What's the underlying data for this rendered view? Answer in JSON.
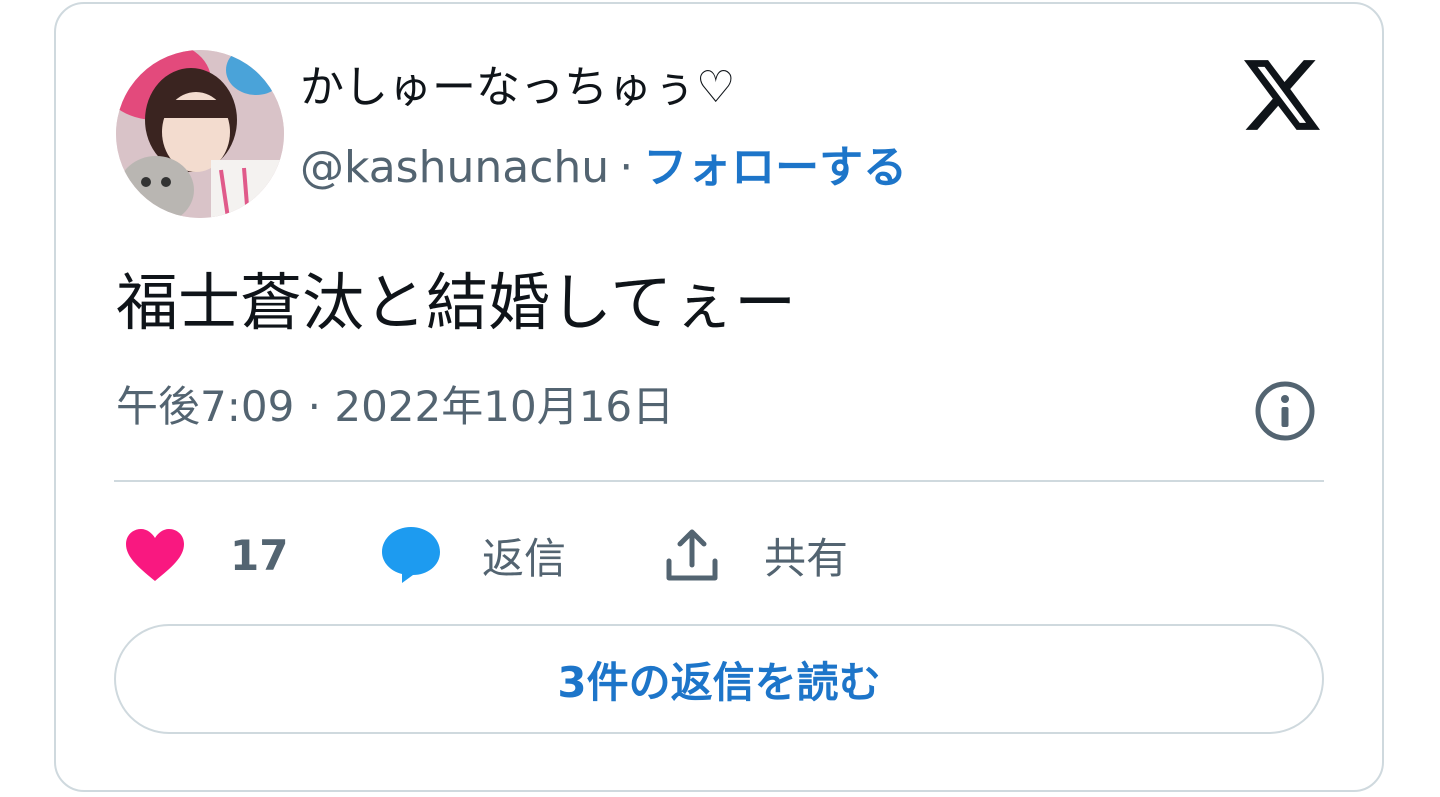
{
  "author": {
    "display_name": "かしゅーなっちゅぅ♡",
    "handle": "@kashunachu",
    "separator": "·",
    "follow_label": "フォローする",
    "avatar_icon": "user-avatar-photo"
  },
  "brand": {
    "logo_icon": "x-logo-icon"
  },
  "tweet": {
    "text": "福士蒼汰と結婚してぇー",
    "timestamp": "午後7:09 · 2022年10月16日"
  },
  "actions": {
    "like_icon": "heart-icon",
    "like_count": "17",
    "reply_icon": "speech-bubble-icon",
    "reply_label": "返信",
    "share_icon": "share-upload-icon",
    "share_label": "共有"
  },
  "footer": {
    "read_replies_label": "3件の返信を読む"
  },
  "colors": {
    "accent_blue": "#1d75c9",
    "like_pink": "#f91880",
    "reply_blue": "#1d9bf0",
    "text_primary": "#0f1419",
    "text_secondary": "#536471",
    "border": "#cfd9de"
  }
}
